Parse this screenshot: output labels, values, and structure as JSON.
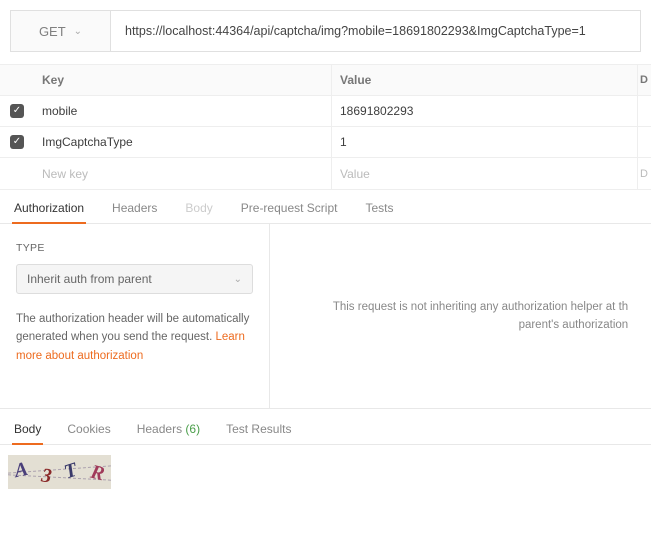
{
  "request": {
    "method": "GET",
    "url": "https://localhost:44364/api/captcha/img?mobile=18691802293&ImgCaptchaType=1"
  },
  "params": {
    "header_key": "Key",
    "header_value": "Value",
    "header_desc": "D",
    "rows": [
      {
        "checked": true,
        "key": "mobile",
        "value": "18691802293"
      },
      {
        "checked": true,
        "key": "ImgCaptchaType",
        "value": "1"
      }
    ],
    "new_key_placeholder": "New key",
    "new_value_placeholder": "Value",
    "new_desc_placeholder": "D"
  },
  "req_tabs": {
    "authorization": "Authorization",
    "headers": "Headers",
    "body": "Body",
    "prerequest": "Pre-request Script",
    "tests": "Tests"
  },
  "auth": {
    "type_label": "TYPE",
    "selected": "Inherit auth from parent",
    "desc_1": "The authorization header will be automatically generated when you send the request. ",
    "learn_more": "Learn more about authorization",
    "right_line1": "This request is not inheriting any authorization helper at th",
    "right_line2": "parent's authorization"
  },
  "resp_tabs": {
    "body": "Body",
    "cookies": "Cookies",
    "headers": "Headers",
    "headers_count": "(6)",
    "test_results": "Test Results"
  },
  "captcha": {
    "c1": "A",
    "c2": "3",
    "c3": "T",
    "c4": "R"
  }
}
